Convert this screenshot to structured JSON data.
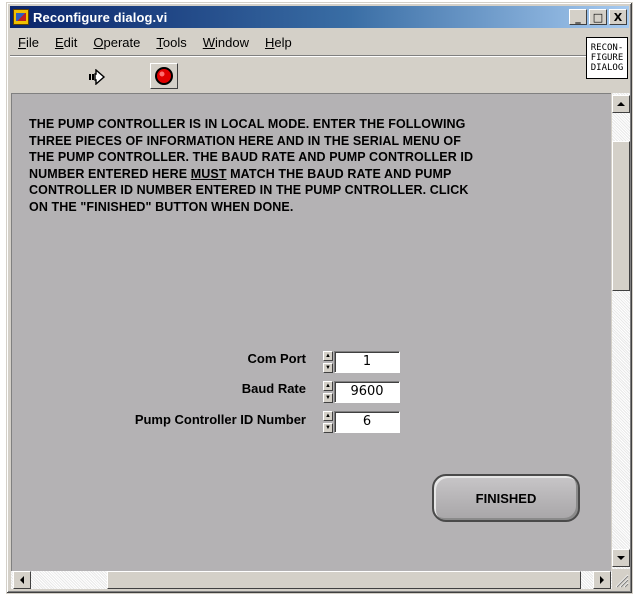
{
  "window": {
    "title": "Reconfigure dialog.vi",
    "minimize_label": "_",
    "maximize_label": "□",
    "close_label": "X"
  },
  "menu": {
    "items": [
      {
        "label": "File",
        "mnemonic": "F",
        "rest": "ile"
      },
      {
        "label": "Edit",
        "mnemonic": "E",
        "rest": "dit"
      },
      {
        "label": "Operate",
        "mnemonic": "O",
        "rest": "perate"
      },
      {
        "label": "Tools",
        "mnemonic": "T",
        "rest": "ools"
      },
      {
        "label": "Window",
        "mnemonic": "W",
        "rest": "indow"
      },
      {
        "label": "Help",
        "mnemonic": "H",
        "rest": "elp"
      }
    ]
  },
  "toolbar": {
    "run_icon": "run-arrow-icon",
    "stop_icon": "stop-icon"
  },
  "vi_icon": {
    "line1": "RECON-",
    "line2": "FIGURE",
    "line3": "DIALOG"
  },
  "instructions": {
    "part1": "THE PUMP CONTROLLER IS IN LOCAL MODE.  ENTER THE FOLLOWING\nTHREE PIECES OF INFORMATION HERE AND IN THE SERIAL MENU OF\nTHE PUMP CONTROLLER.  THE BAUD RATE AND PUMP CONTROLLER ID\nNUMBER ENTERED HERE ",
    "emphasis": "MUST",
    "part2": " MATCH THE BAUD RATE AND PUMP\nCONTROLLER ID NUMBER ENTERED IN THE PUMP CNTROLLER.  CLICK\nON THE \"FINISHED\" BUTTON WHEN DONE."
  },
  "fields": {
    "com_port": {
      "label": "Com Port",
      "value": "1"
    },
    "baud_rate": {
      "label": "Baud Rate",
      "value": "9600"
    },
    "pump_id": {
      "label": "Pump Controller ID Number",
      "value": "6"
    }
  },
  "finished_button": {
    "label": "FINISHED"
  },
  "colors": {
    "panel_bg": "#b4b2b4",
    "chrome_bg": "#d4d0c8",
    "title_start": "#0a246a",
    "title_end": "#a6caf0",
    "stop_red": "#e00000"
  }
}
